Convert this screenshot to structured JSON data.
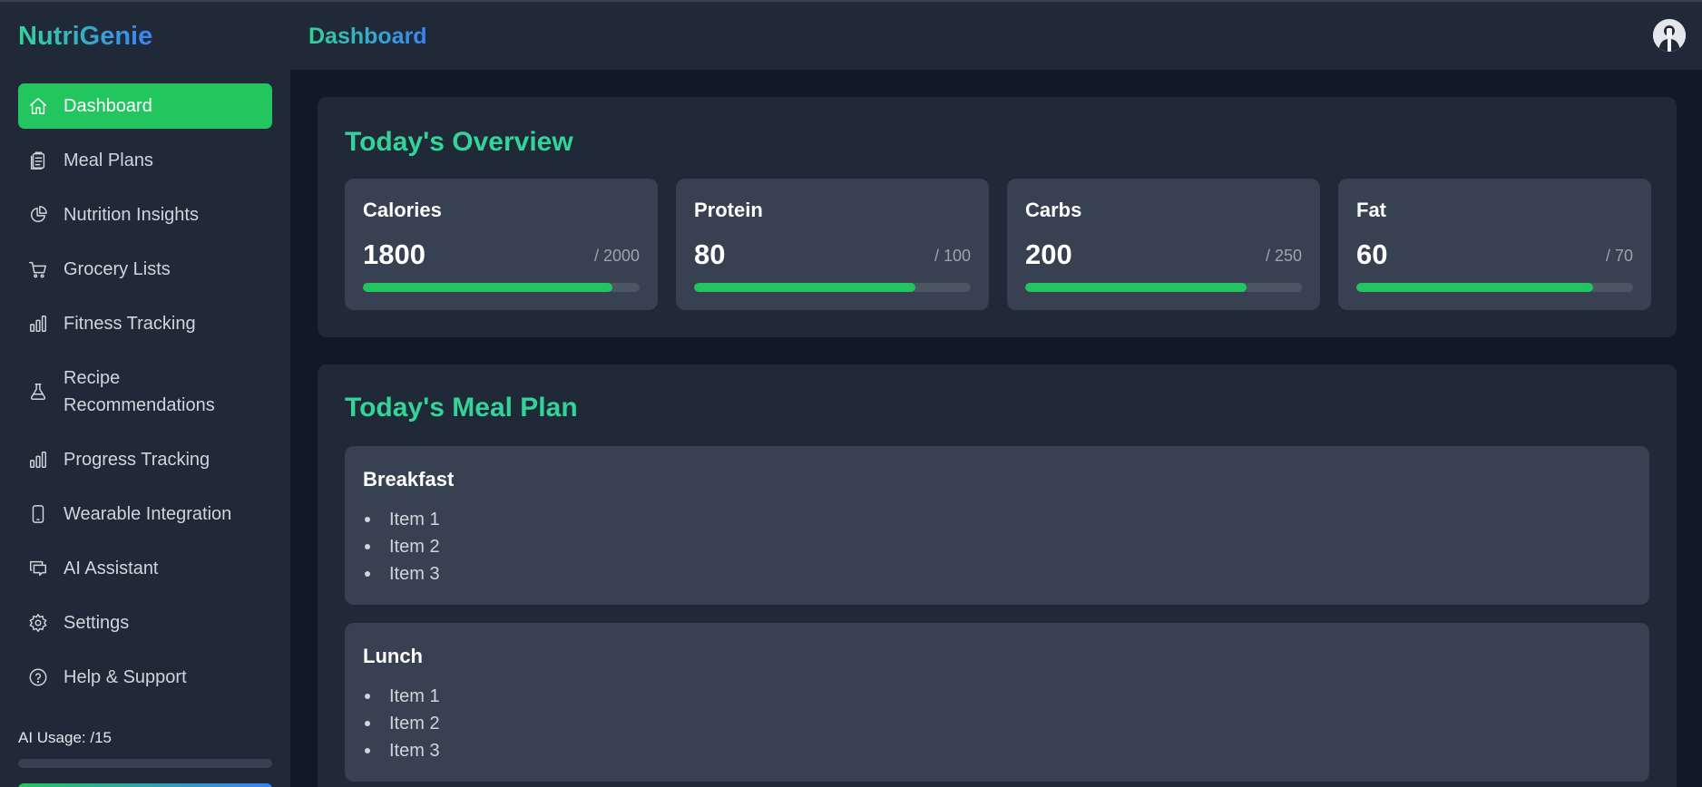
{
  "app": {
    "brand": "NutriGenie"
  },
  "sidebar": {
    "items": [
      {
        "label": "Dashboard",
        "icon": "home-icon",
        "active": true
      },
      {
        "label": "Meal Plans",
        "icon": "clipboard-icon"
      },
      {
        "label": "Nutrition Insights",
        "icon": "pie-chart-icon"
      },
      {
        "label": "Grocery Lists",
        "icon": "cart-icon"
      },
      {
        "label": "Fitness Tracking",
        "icon": "bar-chart-icon"
      },
      {
        "label": "Recipe Recommendations",
        "icon": "flask-icon"
      },
      {
        "label": "Progress Tracking",
        "icon": "bar-chart-icon"
      },
      {
        "label": "Wearable Integration",
        "icon": "phone-icon"
      },
      {
        "label": "AI Assistant",
        "icon": "chat-icon"
      },
      {
        "label": "Settings",
        "icon": "gear-icon"
      },
      {
        "label": "Help & Support",
        "icon": "help-icon"
      }
    ],
    "ai_usage": {
      "label": "AI Usage: /15",
      "progress": 0
    }
  },
  "header": {
    "title": "Dashboard",
    "avatar_icon": "user-avatar"
  },
  "overview": {
    "title": "Today's Overview",
    "stats": [
      {
        "name": "Calories",
        "value": "1800",
        "target": "/ 2000",
        "progress": 0.9
      },
      {
        "name": "Protein",
        "value": "80",
        "target": "/ 100",
        "progress": 0.8
      },
      {
        "name": "Carbs",
        "value": "200",
        "target": "/ 250",
        "progress": 0.8
      },
      {
        "name": "Fat",
        "value": "60",
        "target": "/ 70",
        "progress": 0.857
      }
    ]
  },
  "meal_plan": {
    "title": "Today's Meal Plan",
    "meals": [
      {
        "name": "Breakfast",
        "items": [
          "Item 1",
          "Item 2",
          "Item 3"
        ]
      },
      {
        "name": "Lunch",
        "items": [
          "Item 1",
          "Item 2",
          "Item 3"
        ]
      }
    ]
  },
  "colors": {
    "accent": "#22c55e",
    "title_green": "#34d399",
    "gradient_end": "#3b82f6",
    "card": "#374151",
    "panel": "#1f2937",
    "background": "#111827"
  }
}
